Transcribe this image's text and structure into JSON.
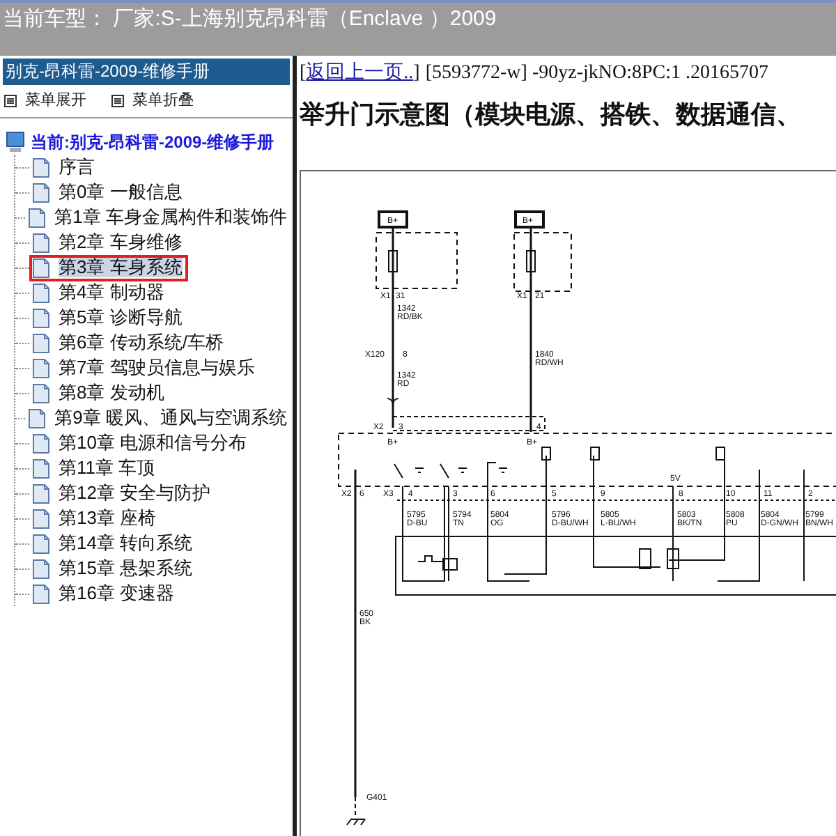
{
  "title_bar": {
    "title": "当前车型： 厂家:S-上海别克昂科雷（Enclave ）2009"
  },
  "sidebar": {
    "header": "别克-昂科雷-2009-维修手册",
    "menu_buttons": [
      "菜单展开",
      "菜单折叠"
    ],
    "tree": {
      "label": "当前:别克-昂科雷-2009-维修手册",
      "children": [
        {
          "label": "序言",
          "selected": false
        },
        {
          "label": "第0章 一般信息",
          "selected": false
        },
        {
          "label": "第1章 车身金属构件和装饰件",
          "selected": false
        },
        {
          "label": "第2章 车身维修",
          "selected": false
        },
        {
          "label": "第3章 车身系统",
          "selected": true
        },
        {
          "label": "第4章 制动器",
          "selected": false
        },
        {
          "label": "第5章 诊断导航",
          "selected": false
        },
        {
          "label": "第6章 传动系统/车桥",
          "selected": false
        },
        {
          "label": "第7章 驾驶员信息与娱乐",
          "selected": false
        },
        {
          "label": "第8章 发动机",
          "selected": false
        },
        {
          "label": "第9章 暖风、通风与空调系统",
          "selected": false
        },
        {
          "label": "第10章 电源和信号分布",
          "selected": false
        },
        {
          "label": "第11章 车顶",
          "selected": false
        },
        {
          "label": "第12章 安全与防护",
          "selected": false
        },
        {
          "label": "第13章 座椅",
          "selected": false
        },
        {
          "label": "第14章 转向系统",
          "selected": false
        },
        {
          "label": "第15章 悬架系统",
          "selected": false
        },
        {
          "label": "第16章 变速器",
          "selected": false
        }
      ]
    }
  },
  "content": {
    "bracket_open": "[",
    "back_link": "返回上一页..",
    "bracket_close": "]",
    "doc_info": "[5593772-w] -90yz-jkNO:8PC:1 .20165707",
    "heading": "举升门示意图（模块电源、搭铁、数据通信、",
    "diagram_labels": [
      "B+",
      "B+",
      "X1",
      "31",
      "X1",
      "21",
      "1342",
      "RD/BK",
      "X120",
      "8",
      "1342",
      "RD",
      "1840",
      "RD/WH",
      "X2",
      "3",
      "4",
      "B+",
      "B+",
      "X2",
      "6",
      "X3",
      "4",
      "3",
      "6",
      "5",
      "9",
      "5V",
      "8",
      "10",
      "11",
      "2",
      "5795",
      "D-BU",
      "5794",
      "TN",
      "5804",
      "OG",
      "5796",
      "D-BU/WH",
      "5805",
      "L-BU/WH",
      "5803",
      "BK/TN",
      "5808",
      "PU",
      "5804",
      "D-GN/WH",
      "5799",
      "BN/WH",
      "650",
      "BK",
      "G401"
    ]
  }
}
